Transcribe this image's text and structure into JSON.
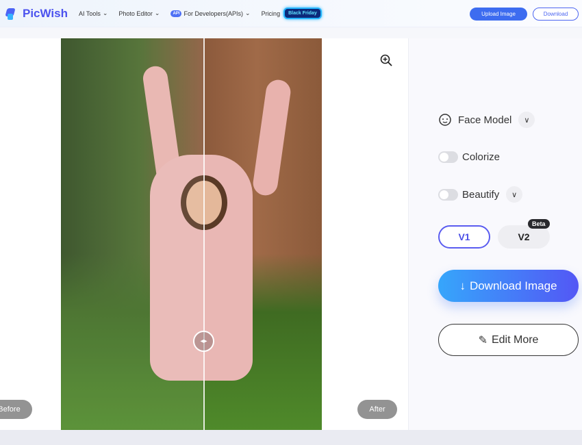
{
  "nav": {
    "brand": "PicWish",
    "menu": [
      {
        "label": "AI Tools"
      },
      {
        "label": "Photo Editor"
      },
      {
        "label": "For Developers(APIs)",
        "badge": "API"
      },
      {
        "label": "Pricing"
      }
    ],
    "promo": "Black Friday",
    "upload": "Upload Image",
    "download": "Download"
  },
  "stage": {
    "before_label": "Before",
    "after_label": "After",
    "compare_handle": "◂▸"
  },
  "panel": {
    "face_model": "Face Model",
    "colorize": "Colorize",
    "colorize_on": false,
    "beautify": "Beautify",
    "beautify_on": false,
    "v1": "V1",
    "v2": "V2",
    "beta": "Beta",
    "download_image": "Download Image",
    "edit_more": "Edit More"
  },
  "colors": {
    "accent": "#4b52ee",
    "gradient_start": "#36a6fb",
    "gradient_end": "#5357f5"
  }
}
